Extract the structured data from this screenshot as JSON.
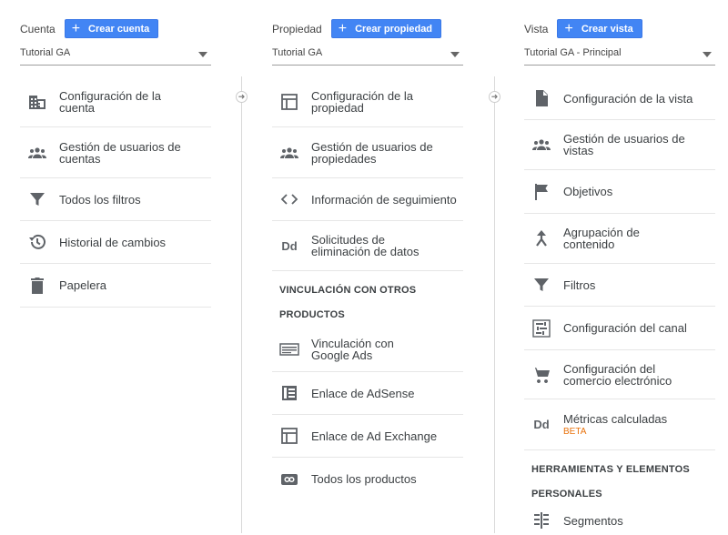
{
  "account": {
    "label": "Cuenta",
    "create_button": "Crear cuenta",
    "selected": "Tutorial GA",
    "items": [
      {
        "label": "Configuración de la cuenta"
      },
      {
        "label": "Gestión de usuarios de cuentas"
      },
      {
        "label": "Todos los filtros"
      },
      {
        "label": "Historial de cambios"
      },
      {
        "label": "Papelera"
      }
    ]
  },
  "property": {
    "label": "Propiedad",
    "create_button": "Crear propiedad",
    "selected": "Tutorial GA",
    "items": [
      {
        "label": "Configuración de la propiedad"
      },
      {
        "label": "Gestión de usuarios de propiedades"
      },
      {
        "label": "Información de seguimiento"
      },
      {
        "label": "Solicitudes de eliminación de datos"
      }
    ],
    "section_title_1": "VINCULACIÓN CON OTROS",
    "section_title_2": "PRODUCTOS",
    "product_items": [
      {
        "label": "Vinculación con Google Ads"
      },
      {
        "label": "Enlace de AdSense"
      },
      {
        "label": "Enlace de Ad Exchange"
      },
      {
        "label": "Todos los productos"
      }
    ]
  },
  "view": {
    "label": "Vista",
    "create_button": "Crear vista",
    "selected": "Tutorial GA - Principal",
    "items": [
      {
        "label": "Configuración de la vista"
      },
      {
        "label": "Gestión de usuarios de vistas"
      },
      {
        "label": "Objetivos"
      },
      {
        "label": "Agrupación de contenido"
      },
      {
        "label": "Filtros"
      },
      {
        "label": "Configuración del canal"
      },
      {
        "label": "Configuración del comercio electrónico"
      },
      {
        "label": "Métricas calculadas",
        "badge": "BETA"
      }
    ],
    "section_title_1": "HERRAMIENTAS Y ELEMENTOS",
    "section_title_2": "PERSONALES",
    "tool_items": [
      {
        "label": "Segmentos"
      }
    ]
  },
  "colors": {
    "accent": "#4285f4",
    "beta": "#e8710a",
    "icon": "#5f6368"
  }
}
